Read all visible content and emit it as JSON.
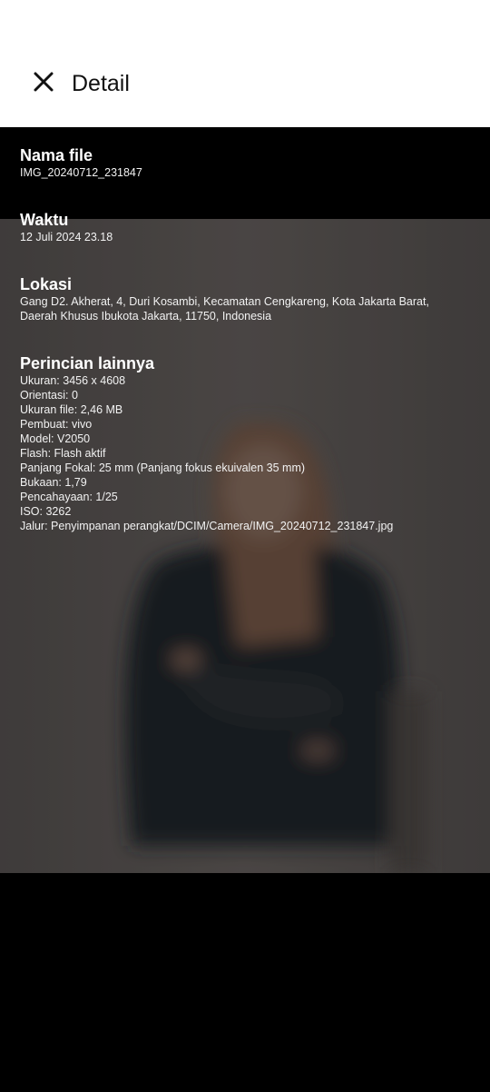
{
  "header": {
    "title": "Detail",
    "close_icon": "close-icon"
  },
  "sections": {
    "file_name": {
      "title": "Nama file",
      "value": "IMG_20240712_231847"
    },
    "time": {
      "title": "Waktu",
      "value": "12 Juli 2024 23.18"
    },
    "location": {
      "title": "Lokasi",
      "line1": "Gang D2. Akherat, 4, Duri Kosambi, Kecamatan Cengkareng, Kota Jakarta Barat,",
      "line2": "Daerah Khusus Ibukota Jakarta, 11750, Indonesia"
    },
    "other": {
      "title": "Perincian lainnya",
      "lines": [
        "Ukuran: 3456 x 4608",
        "Orientasi: 0",
        "Ukuran file: 2,46 MB",
        "Pembuat: vivo",
        "Model: V2050",
        "Flash: Flash aktif",
        "Panjang Fokal: 25 mm (Panjang fokus ekuivalen 35 mm)",
        "Bukaan: 1,79",
        "Pencahayaan: 1/25",
        "ISO: 3262",
        "Jalur: Penyimpanan perangkat/DCIM/Camera/IMG_20240712_231847.jpg"
      ]
    }
  },
  "colors": {
    "topbar_bg": "#ffffff",
    "background": "#000000",
    "text": "#ffffff"
  }
}
